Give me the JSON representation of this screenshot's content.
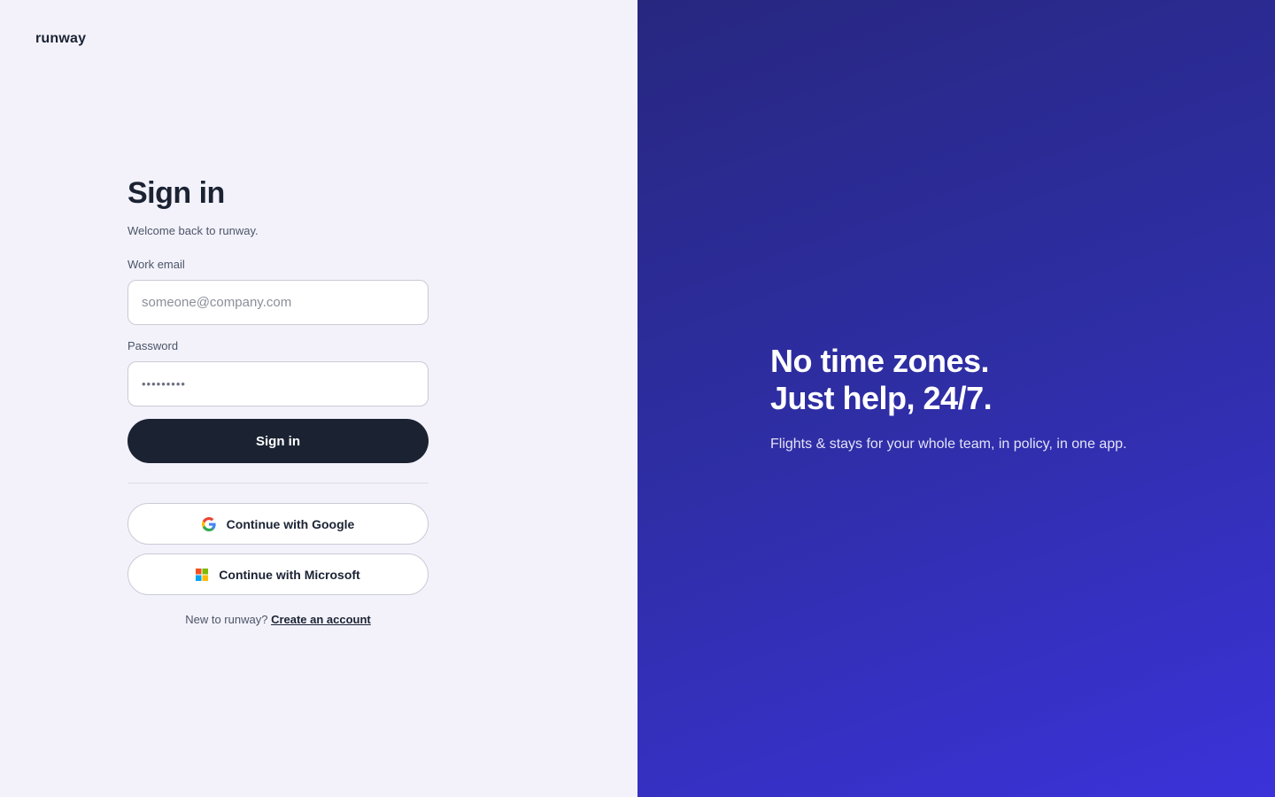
{
  "brand": {
    "name": "runway"
  },
  "signin": {
    "title": "Sign in",
    "subtitle": "Welcome back to runway.",
    "email": {
      "label": "Work email",
      "placeholder": "someone@company.com",
      "value": ""
    },
    "password": {
      "label": "Password",
      "masked_value": "•••••••••"
    },
    "submit_label": "Sign in",
    "google_label": "Continue with Google",
    "microsoft_label": "Continue with Microsoft",
    "signup_prompt": "New to runway?",
    "signup_link": "Create an account"
  },
  "hero": {
    "headline_line1": "No time zones.",
    "headline_line2": "Just help, 24/7.",
    "tagline": "Flights & stays for your whole team, in policy, in one app."
  },
  "colors": {
    "left_bg": "#f3f2fb",
    "primary_button": "#1b2333",
    "right_gradient_start": "#272780",
    "right_gradient_end": "#3b32d9"
  },
  "icons": {
    "google": "google-icon",
    "microsoft": "microsoft-icon"
  }
}
